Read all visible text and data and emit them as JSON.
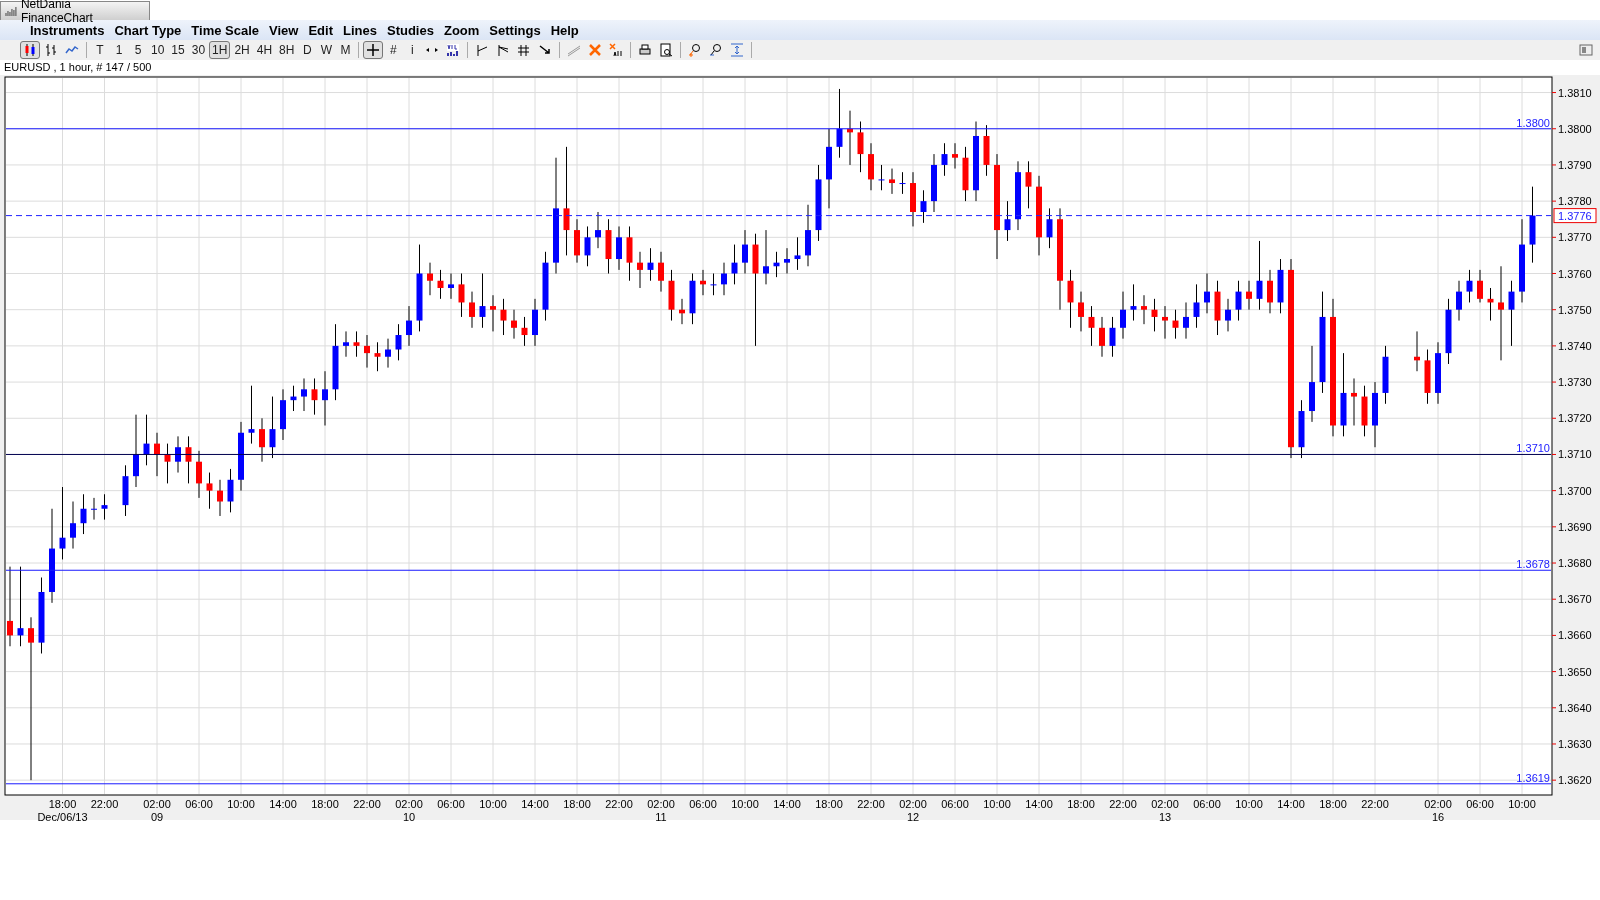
{
  "window": {
    "title": "NetDania FinanceChart"
  },
  "menu": [
    "Instruments",
    "Chart Type",
    "Time Scale",
    "View",
    "Edit",
    "Lines",
    "Studies",
    "Zoom",
    "Settings",
    "Help"
  ],
  "toolbar": [
    {
      "kind": "candles",
      "selected": true
    },
    {
      "kind": "bars",
      "selected": false
    },
    {
      "kind": "line",
      "selected": false
    },
    {
      "kind": "sep"
    },
    {
      "kind": "text",
      "label": "T",
      "selected": false
    },
    {
      "kind": "text",
      "label": "1",
      "selected": false
    },
    {
      "kind": "text",
      "label": "5",
      "selected": false
    },
    {
      "kind": "text",
      "label": "10",
      "selected": false
    },
    {
      "kind": "text",
      "label": "15",
      "selected": false
    },
    {
      "kind": "text",
      "label": "30",
      "selected": false
    },
    {
      "kind": "text",
      "label": "1H",
      "selected": true
    },
    {
      "kind": "text",
      "label": "2H",
      "selected": false
    },
    {
      "kind": "text",
      "label": "4H",
      "selected": false
    },
    {
      "kind": "text",
      "label": "8H",
      "selected": false
    },
    {
      "kind": "text",
      "label": "D",
      "selected": false
    },
    {
      "kind": "text",
      "label": "W",
      "selected": false
    },
    {
      "kind": "text",
      "label": "M",
      "selected": false
    },
    {
      "kind": "sep"
    },
    {
      "kind": "crosshair",
      "selected": true
    },
    {
      "kind": "text",
      "label": "#",
      "selected": false
    },
    {
      "kind": "text",
      "label": "i",
      "selected": false
    },
    {
      "kind": "arrows",
      "selected": false
    },
    {
      "kind": "volume",
      "selected": false
    },
    {
      "kind": "sep"
    },
    {
      "kind": "trend",
      "selected": false
    },
    {
      "kind": "fan",
      "selected": false
    },
    {
      "kind": "fork",
      "selected": false
    },
    {
      "kind": "ray",
      "selected": false
    },
    {
      "kind": "sep"
    },
    {
      "kind": "pen",
      "selected": false
    },
    {
      "kind": "delete",
      "selected": false
    },
    {
      "kind": "deleteall",
      "selected": false
    },
    {
      "kind": "sep"
    },
    {
      "kind": "print",
      "selected": false
    },
    {
      "kind": "preview",
      "selected": false
    },
    {
      "kind": "sep"
    },
    {
      "kind": "zoomin",
      "selected": false
    },
    {
      "kind": "zoomout",
      "selected": false
    },
    {
      "kind": "fit",
      "selected": false
    },
    {
      "kind": "sep"
    },
    {
      "kind": "panel",
      "selected": false
    }
  ],
  "chart": {
    "info": "EURUSD , 1 hour, # 147 / 500",
    "dates": [
      "Dec/06/13",
      "09",
      "10",
      "11",
      "12",
      "13",
      "16"
    ],
    "chart_data": {
      "type": "candlestick",
      "ylim": [
        1.36159,
        1.38143
      ],
      "grid": true,
      "ref_lines": [
        {
          "axis": "y",
          "value": 1.38,
          "label": "1.3800",
          "color": "#1a1aff"
        },
        {
          "axis": "y",
          "value": 1.371,
          "label": "1.3710",
          "color": "#000050"
        },
        {
          "axis": "y",
          "value": 1.3678,
          "label": "1.3678",
          "color": "#1a1aff"
        },
        {
          "axis": "y",
          "value": 1.3619,
          "label": "1.3619",
          "color": "#1a1aff"
        },
        {
          "axis": "y",
          "value": 1.3776,
          "label": "1.3776",
          "color": "#2020ff"
        }
      ],
      "yticks": [
        {
          "value": 1.381,
          "label": "1.3810"
        },
        {
          "value": 1.38,
          "label": "1.3800"
        },
        {
          "value": 1.379,
          "label": "1.3790"
        },
        {
          "value": 1.378,
          "label": "1.3780"
        },
        {
          "value": 1.377,
          "label": "1.3770"
        },
        {
          "value": 1.376,
          "label": "1.3760"
        },
        {
          "value": 1.375,
          "label": "1.3750"
        },
        {
          "value": 1.374,
          "label": "1.3740"
        },
        {
          "value": 1.373,
          "label": "1.3730"
        },
        {
          "value": 1.372,
          "label": "1.3720"
        },
        {
          "value": 1.371,
          "label": "1.3710"
        },
        {
          "value": 1.37,
          "label": "1.3700"
        },
        {
          "value": 1.369,
          "label": "1.3690"
        },
        {
          "value": 1.368,
          "label": "1.3680"
        },
        {
          "value": 1.367,
          "label": "1.3670"
        },
        {
          "value": 1.366,
          "label": "1.3660"
        },
        {
          "value": 1.365,
          "label": "1.3650"
        },
        {
          "value": 1.364,
          "label": "1.3640"
        },
        {
          "value": 1.363,
          "label": "1.3630"
        },
        {
          "value": 1.362,
          "label": "1.3620"
        }
      ],
      "categories": [
        null,
        null,
        null,
        null,
        null,
        "18:00",
        null,
        null,
        null,
        "22:00",
        null,
        null,
        null,
        null,
        "02:00",
        null,
        null,
        null,
        "06:00",
        null,
        null,
        null,
        "10:00",
        null,
        null,
        null,
        "14:00",
        null,
        null,
        null,
        "18:00",
        null,
        null,
        null,
        "22:00",
        null,
        null,
        null,
        "02:00",
        null,
        null,
        null,
        "06:00",
        null,
        null,
        null,
        "10:00",
        null,
        null,
        null,
        "14:00",
        null,
        null,
        null,
        "18:00",
        null,
        null,
        null,
        "22:00",
        null,
        null,
        null,
        "02:00",
        null,
        null,
        null,
        "06:00",
        null,
        null,
        null,
        "10:00",
        null,
        null,
        null,
        "14:00",
        null,
        null,
        null,
        "18:00",
        null,
        null,
        null,
        "22:00",
        null,
        null,
        null,
        "02:00",
        null,
        null,
        null,
        "06:00",
        null,
        null,
        null,
        "10:00",
        null,
        null,
        null,
        "14:00",
        null,
        null,
        null,
        "18:00",
        null,
        null,
        null,
        "22:00",
        null,
        null,
        null,
        "02:00",
        null,
        null,
        null,
        "06:00",
        null,
        null,
        null,
        "10:00",
        null,
        null,
        null,
        "14:00",
        null,
        null,
        null,
        "18:00",
        null,
        null,
        null,
        "22:00",
        null,
        null,
        null,
        null,
        null,
        "02:00",
        null,
        null,
        null,
        "06:00",
        null,
        null,
        null,
        "10:00",
        null
      ],
      "ohlc": [
        [
          1.3664,
          1.3679,
          1.3657,
          1.366
        ],
        [
          1.366,
          1.3679,
          1.3657,
          1.3662
        ],
        [
          1.3662,
          1.3665,
          1.362,
          1.3658
        ],
        [
          1.3658,
          1.3676,
          1.3655,
          1.3672
        ],
        [
          1.3672,
          1.3695,
          1.3669,
          1.3684
        ],
        [
          1.3684,
          1.3701,
          1.3681,
          1.3687
        ],
        [
          1.3687,
          1.3697,
          1.3684,
          1.3691
        ],
        [
          1.3691,
          1.3699,
          1.3688,
          1.3695
        ],
        [
          1.3695,
          1.3698,
          1.3692,
          1.3695
        ],
        [
          1.3695,
          1.3699,
          1.3692,
          1.3696
        ],
        null,
        [
          1.3696,
          1.3707,
          1.3693,
          1.3704
        ],
        [
          1.3704,
          1.3721,
          1.3701,
          1.371
        ],
        [
          1.371,
          1.3721,
          1.3707,
          1.3713
        ],
        [
          1.3713,
          1.3716,
          1.3704,
          1.371
        ],
        [
          1.371,
          1.3713,
          1.3702,
          1.3708
        ],
        [
          1.3708,
          1.3715,
          1.3705,
          1.3712
        ],
        [
          1.3712,
          1.3715,
          1.3702,
          1.3708
        ],
        [
          1.3708,
          1.3711,
          1.3698,
          1.3702
        ],
        [
          1.3702,
          1.3705,
          1.3695,
          1.37
        ],
        [
          1.37,
          1.3703,
          1.3693,
          1.3697
        ],
        [
          1.3697,
          1.3706,
          1.3694,
          1.3703
        ],
        [
          1.3703,
          1.3719,
          1.37,
          1.3716
        ],
        [
          1.3716,
          1.3729,
          1.3713,
          1.3717
        ],
        [
          1.3717,
          1.372,
          1.3708,
          1.3712
        ],
        [
          1.3712,
          1.3726,
          1.3709,
          1.3717
        ],
        [
          1.3717,
          1.3728,
          1.3714,
          1.3725
        ],
        [
          1.3725,
          1.3729,
          1.3722,
          1.3726
        ],
        [
          1.3726,
          1.3731,
          1.3722,
          1.3728
        ],
        [
          1.3728,
          1.3731,
          1.3721,
          1.3725
        ],
        [
          1.3725,
          1.3733,
          1.3718,
          1.3728
        ],
        [
          1.3728,
          1.3746,
          1.3725,
          1.374
        ],
        [
          1.374,
          1.3744,
          1.3737,
          1.3741
        ],
        [
          1.3741,
          1.3744,
          1.3737,
          1.374
        ],
        [
          1.374,
          1.3743,
          1.3734,
          1.3738
        ],
        [
          1.3738,
          1.3741,
          1.3733,
          1.3737
        ],
        [
          1.3737,
          1.3742,
          1.3734,
          1.3739
        ],
        [
          1.3739,
          1.3746,
          1.3736,
          1.3743
        ],
        [
          1.3743,
          1.3751,
          1.374,
          1.3747
        ],
        [
          1.3747,
          1.3768,
          1.3744,
          1.376
        ],
        [
          1.376,
          1.3763,
          1.3754,
          1.3758
        ],
        [
          1.3758,
          1.3761,
          1.3753,
          1.3756
        ],
        [
          1.3756,
          1.376,
          1.3753,
          1.3757
        ],
        [
          1.3757,
          1.376,
          1.3748,
          1.3752
        ],
        [
          1.3752,
          1.3755,
          1.3745,
          1.3748
        ],
        [
          1.3748,
          1.376,
          1.3745,
          1.3751
        ],
        [
          1.3751,
          1.3754,
          1.3744,
          1.375
        ],
        [
          1.375,
          1.3753,
          1.3743,
          1.3747
        ],
        [
          1.3747,
          1.375,
          1.3742,
          1.3745
        ],
        [
          1.3745,
          1.3748,
          1.374,
          1.3743
        ],
        [
          1.3743,
          1.3753,
          1.374,
          1.375
        ],
        [
          1.375,
          1.3766,
          1.3747,
          1.3763
        ],
        [
          1.3763,
          1.3792,
          1.376,
          1.3778
        ],
        [
          1.3778,
          1.3795,
          1.3765,
          1.3772
        ],
        [
          1.3772,
          1.3775,
          1.3763,
          1.3765
        ],
        [
          1.3765,
          1.3773,
          1.3762,
          1.377
        ],
        [
          1.377,
          1.3777,
          1.3767,
          1.3772
        ],
        [
          1.3772,
          1.3775,
          1.376,
          1.3764
        ],
        [
          1.3764,
          1.3773,
          1.3761,
          1.377
        ],
        [
          1.377,
          1.3773,
          1.3758,
          1.3763
        ],
        [
          1.3763,
          1.3766,
          1.3756,
          1.3761
        ],
        [
          1.3761,
          1.3767,
          1.3758,
          1.3763
        ],
        [
          1.3763,
          1.3766,
          1.3755,
          1.3758
        ],
        [
          1.3758,
          1.3761,
          1.3747,
          1.375
        ],
        [
          1.375,
          1.3753,
          1.3746,
          1.3749
        ],
        [
          1.3749,
          1.376,
          1.3746,
          1.3758
        ],
        [
          1.3758,
          1.3761,
          1.3754,
          1.3757
        ],
        [
          1.3757,
          1.376,
          1.3754,
          1.3757
        ],
        [
          1.3757,
          1.3763,
          1.3754,
          1.376
        ],
        [
          1.376,
          1.3768,
          1.3757,
          1.3763
        ],
        [
          1.3763,
          1.3772,
          1.376,
          1.3768
        ],
        [
          1.3768,
          1.3771,
          1.374,
          1.376
        ],
        [
          1.376,
          1.3772,
          1.3757,
          1.3762
        ],
        [
          1.3762,
          1.3766,
          1.3759,
          1.3763
        ],
        [
          1.3763,
          1.3767,
          1.376,
          1.3764
        ],
        [
          1.3764,
          1.377,
          1.3761,
          1.3765
        ],
        [
          1.3765,
          1.3779,
          1.3762,
          1.3772
        ],
        [
          1.3772,
          1.379,
          1.3769,
          1.3786
        ],
        [
          1.3786,
          1.38,
          1.3778,
          1.3795
        ],
        [
          1.3795,
          1.3811,
          1.3792,
          1.38
        ],
        [
          1.38,
          1.3805,
          1.379,
          1.3799
        ],
        [
          1.3799,
          1.3802,
          1.3788,
          1.3793
        ],
        [
          1.3793,
          1.3796,
          1.3783,
          1.3786
        ],
        [
          1.3786,
          1.379,
          1.3783,
          1.3786
        ],
        [
          1.3786,
          1.3789,
          1.3782,
          1.3785
        ],
        [
          1.3785,
          1.3788,
          1.3782,
          1.3785
        ],
        [
          1.3785,
          1.3788,
          1.3773,
          1.3777
        ],
        [
          1.3777,
          1.3783,
          1.3774,
          1.378
        ],
        [
          1.378,
          1.3793,
          1.3777,
          1.379
        ],
        [
          1.379,
          1.3796,
          1.3787,
          1.3793
        ],
        [
          1.3793,
          1.3796,
          1.3789,
          1.3792
        ],
        [
          1.3792,
          1.3795,
          1.378,
          1.3783
        ],
        [
          1.3783,
          1.3802,
          1.378,
          1.3798
        ],
        [
          1.3798,
          1.3801,
          1.3787,
          1.379
        ],
        [
          1.379,
          1.3793,
          1.3764,
          1.3772
        ],
        [
          1.3772,
          1.378,
          1.3769,
          1.3775
        ],
        [
          1.3775,
          1.3791,
          1.3772,
          1.3788
        ],
        [
          1.3788,
          1.3791,
          1.3778,
          1.3784
        ],
        [
          1.3784,
          1.3787,
          1.3765,
          1.377
        ],
        [
          1.377,
          1.3778,
          1.3767,
          1.3775
        ],
        [
          1.3775,
          1.3778,
          1.375,
          1.3758
        ],
        [
          1.3758,
          1.3761,
          1.3745,
          1.3752
        ],
        [
          1.3752,
          1.3755,
          1.3744,
          1.3748
        ],
        [
          1.3748,
          1.3751,
          1.374,
          1.3745
        ],
        [
          1.3745,
          1.3748,
          1.3737,
          1.374
        ],
        [
          1.374,
          1.3748,
          1.3737,
          1.3745
        ],
        [
          1.3745,
          1.3755,
          1.3742,
          1.375
        ],
        [
          1.375,
          1.3757,
          1.3747,
          1.3751
        ],
        [
          1.3751,
          1.3754,
          1.3746,
          1.375
        ],
        [
          1.375,
          1.3753,
          1.3744,
          1.3748
        ],
        [
          1.3748,
          1.3751,
          1.3742,
          1.3747
        ],
        [
          1.3747,
          1.375,
          1.3742,
          1.3745
        ],
        [
          1.3745,
          1.3752,
          1.3742,
          1.3748
        ],
        [
          1.3748,
          1.3757,
          1.3745,
          1.3752
        ],
        [
          1.3752,
          1.376,
          1.3749,
          1.3755
        ],
        [
          1.3755,
          1.3758,
          1.3743,
          1.3747
        ],
        [
          1.3747,
          1.3753,
          1.3744,
          1.375
        ],
        [
          1.375,
          1.3758,
          1.3747,
          1.3755
        ],
        [
          1.3755,
          1.3758,
          1.375,
          1.3753
        ],
        [
          1.3753,
          1.3769,
          1.375,
          1.3758
        ],
        [
          1.3758,
          1.3761,
          1.3749,
          1.3752
        ],
        [
          1.3752,
          1.3764,
          1.3749,
          1.3761
        ],
        [
          1.3761,
          1.3764,
          1.3709,
          1.3712
        ],
        [
          1.3712,
          1.3725,
          1.3709,
          1.3722
        ],
        [
          1.3722,
          1.374,
          1.3719,
          1.373
        ],
        [
          1.373,
          1.3755,
          1.3727,
          1.3748
        ],
        [
          1.3748,
          1.3753,
          1.3715,
          1.3718
        ],
        [
          1.3718,
          1.3738,
          1.3715,
          1.3727
        ],
        [
          1.3727,
          1.3731,
          1.3718,
          1.3726
        ],
        [
          1.3726,
          1.3729,
          1.3715,
          1.3718
        ],
        [
          1.3718,
          1.373,
          1.3712,
          1.3727
        ],
        [
          1.3727,
          1.374,
          1.3724,
          1.3737
        ],
        null,
        null,
        [
          1.3737,
          1.3744,
          1.3733,
          1.3736
        ],
        [
          1.3736,
          1.3739,
          1.3724,
          1.3727
        ],
        [
          1.3727,
          1.3741,
          1.3724,
          1.3738
        ],
        [
          1.3738,
          1.3753,
          1.3735,
          1.375
        ],
        [
          1.375,
          1.3758,
          1.3747,
          1.3755
        ],
        [
          1.3755,
          1.3761,
          1.3752,
          1.3758
        ],
        [
          1.3758,
          1.3761,
          1.3752,
          1.3753
        ],
        [
          1.3753,
          1.3756,
          1.3747,
          1.3752
        ],
        [
          1.3752,
          1.3762,
          1.3736,
          1.375
        ],
        [
          1.375,
          1.3758,
          1.374,
          1.3755
        ],
        [
          1.3755,
          1.3775,
          1.3752,
          1.3768
        ],
        [
          1.3768,
          1.3784,
          1.3763,
          1.3776
        ]
      ]
    }
  }
}
